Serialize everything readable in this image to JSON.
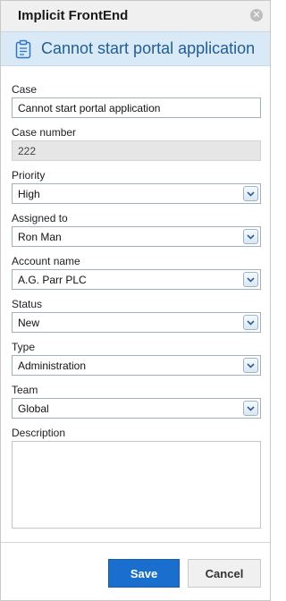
{
  "window": {
    "app_title": "Implicit FrontEnd",
    "close_icon": "close-icon"
  },
  "header": {
    "title": "Cannot start portal application",
    "icon": "clipboard-icon"
  },
  "form": {
    "case": {
      "label": "Case",
      "value": "Cannot start portal application"
    },
    "case_number": {
      "label": "Case number",
      "value": "222"
    },
    "priority": {
      "label": "Priority",
      "value": "High"
    },
    "assigned_to": {
      "label": "Assigned to",
      "value": "Ron Man"
    },
    "account_name": {
      "label": "Account name",
      "value": "A.G. Parr PLC"
    },
    "status": {
      "label": "Status",
      "value": "New"
    },
    "type": {
      "label": "Type",
      "value": "Administration"
    },
    "team": {
      "label": "Team",
      "value": "Global"
    },
    "description": {
      "label": "Description",
      "value": ""
    }
  },
  "actions": {
    "save_label": "Save",
    "cancel_label": "Cancel"
  },
  "colors": {
    "accent": "#1a6fce",
    "header_bg": "#d9e9f6",
    "header_text": "#1f5e96"
  }
}
